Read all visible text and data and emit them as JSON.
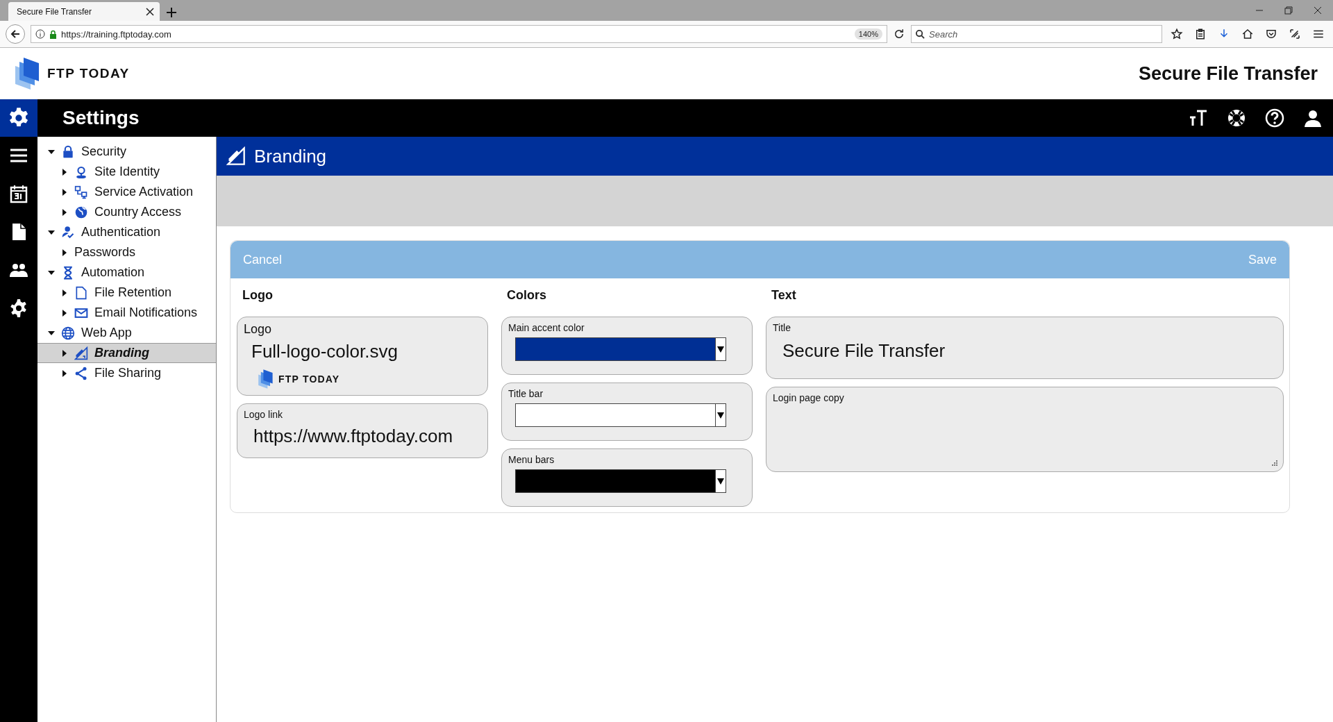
{
  "browser": {
    "tab_title": "Secure File Transfer",
    "url": "https://training.ftptoday.com",
    "zoom": "140%",
    "search_placeholder": "Search"
  },
  "header": {
    "brand": "FTP TODAY",
    "title": "Secure File Transfer"
  },
  "toolbar": {
    "title": "Settings"
  },
  "tree": [
    {
      "label": "Security",
      "expanded": true,
      "selected": false,
      "children": [
        {
          "label": "Site Identity",
          "expanded": false,
          "selected": false
        },
        {
          "label": "Service Activation",
          "expanded": false,
          "selected": false
        },
        {
          "label": "Country Access",
          "expanded": false,
          "selected": false
        }
      ]
    },
    {
      "label": "Authentication",
      "expanded": true,
      "selected": false,
      "children": [
        {
          "label": "Passwords",
          "expanded": false,
          "selected": false
        }
      ]
    },
    {
      "label": "Automation",
      "expanded": true,
      "selected": false,
      "children": [
        {
          "label": "File Retention",
          "expanded": false,
          "selected": false
        },
        {
          "label": "Email Notifications",
          "expanded": false,
          "selected": false
        }
      ]
    },
    {
      "label": "Web App",
      "expanded": true,
      "selected": false,
      "children": [
        {
          "label": "Branding",
          "expanded": false,
          "selected": true
        },
        {
          "label": "File Sharing",
          "expanded": false,
          "selected": false
        }
      ]
    }
  ],
  "page": {
    "title": "Branding"
  },
  "form": {
    "cancel": "Cancel",
    "save": "Save",
    "logo": {
      "heading": "Logo",
      "logo_field": {
        "label": "Logo",
        "value": "Full-logo-color.svg",
        "preview_text": "FTP TODAY"
      },
      "link_field": {
        "label": "Logo link",
        "value": "https://www.ftptoday.com"
      }
    },
    "colors": {
      "heading": "Colors",
      "fields": [
        {
          "label": "Main accent color",
          "color": "#002f94"
        },
        {
          "label": "Title bar",
          "color": "#ffffff"
        },
        {
          "label": "Menu bars",
          "color": "#000000"
        }
      ]
    },
    "text": {
      "heading": "Text",
      "title_field": {
        "label": "Title",
        "value": "Secure File Transfer"
      },
      "copy_field": {
        "label": "Login page copy"
      }
    }
  }
}
